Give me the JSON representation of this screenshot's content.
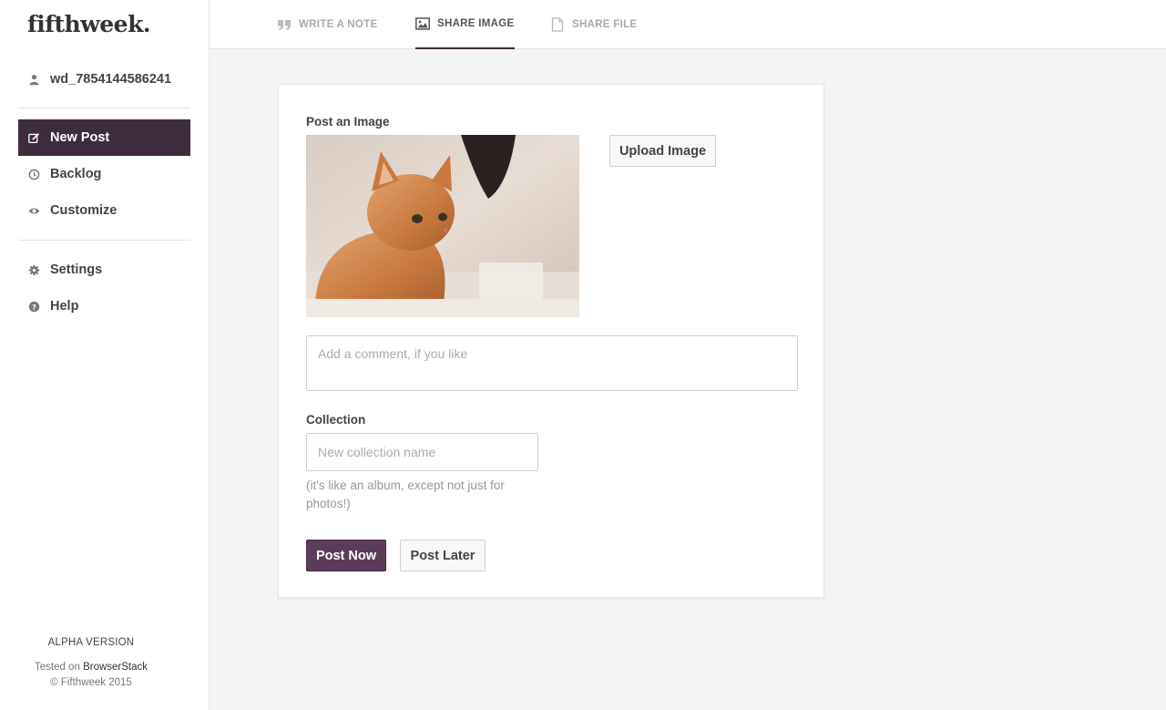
{
  "app": {
    "logo": "fifthweek."
  },
  "sidebar": {
    "username": "wd_7854144586241",
    "items": [
      {
        "label": "New Post",
        "icon": "edit-icon"
      },
      {
        "label": "Backlog",
        "icon": "clock-icon"
      },
      {
        "label": "Customize",
        "icon": "eye-icon"
      },
      {
        "label": "Settings",
        "icon": "gear-icon"
      },
      {
        "label": "Help",
        "icon": "question-circle-icon"
      }
    ],
    "footer": {
      "version": "ALPHA VERSION",
      "tested_prefix": "Tested on",
      "tested_brand": "BrowserStack",
      "copyright": "© Fifthweek 2015"
    }
  },
  "tabs": [
    {
      "label": "WRITE A NOTE",
      "icon": "quote-icon",
      "active": false
    },
    {
      "label": "SHARE IMAGE",
      "icon": "image-icon",
      "active": true
    },
    {
      "label": "SHARE FILE",
      "icon": "file-icon",
      "active": false
    }
  ],
  "form": {
    "image_label": "Post an Image",
    "upload_button": "Upload Image",
    "comment_placeholder": "Add a comment, if you like",
    "collection_label": "Collection",
    "collection_placeholder": "New collection name",
    "collection_help": "(it's like an album, except not just for photos!)",
    "post_now": "Post Now",
    "post_later": "Post Later"
  },
  "colors": {
    "accent": "#3e2c3d",
    "button_primary": "#5b3c58"
  }
}
